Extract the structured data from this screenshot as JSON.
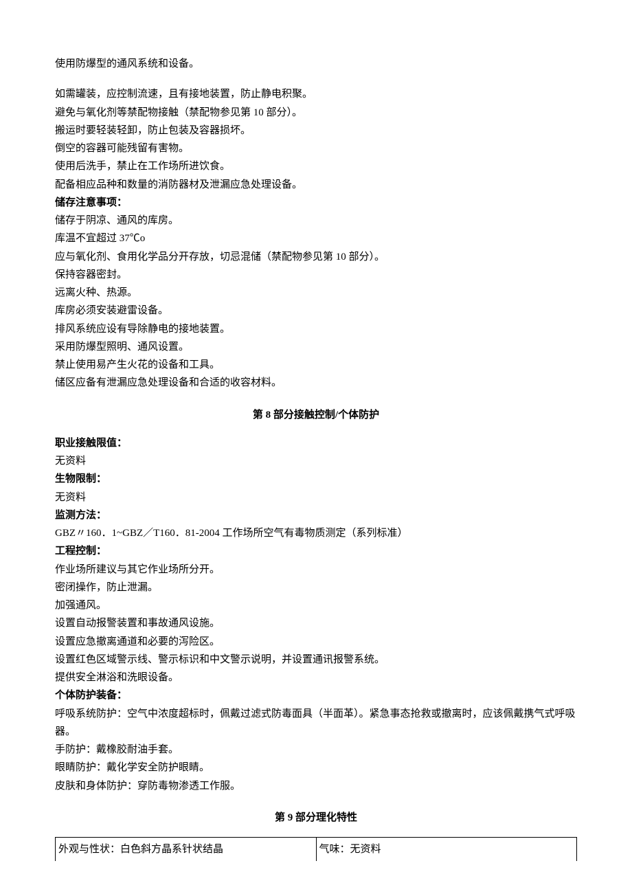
{
  "handling": {
    "lines": [
      "使用防爆型的通风系统和设备。",
      "",
      "如需罐装，应控制流速，且有接地装置，防止静电积聚。",
      "避免与氧化剂等禁配物接触（禁配物参见第 10 部分）。",
      "搬运时要轻装轻卸，防止包装及容器损坏。",
      "倒空的容器可能残留有害物。",
      "使用后洗手，禁止在工作场所进饮食。",
      "配备相应品种和数量的消防器材及泄漏应急处理设备。"
    ]
  },
  "storage": {
    "heading": "储存注意事项：",
    "lines": [
      "储存于阴凉、通风的库房。",
      "库温不宜超过 37℃o",
      "应与氧化剂、食用化学品分开存放，切忌混储（禁配物参见第 10 部分）。",
      "保持容器密封。",
      "远离火种、热源。",
      "库房必须安装避雷设备。",
      "排风系统应设有导除静电的接地装置。",
      "采用防爆型照明、通风设置。",
      "禁止使用易产生火花的设备和工具。",
      "储区应备有泄漏应急处理设备和合适的收容材料。"
    ]
  },
  "section8": {
    "title": "第 8 部分接触控制/个体防护",
    "occ_limit_label": "职业接触限值：",
    "occ_limit_value": "无资料",
    "bio_limit_label": "生物限制：",
    "bio_limit_value": "无资料",
    "monitor_label": "监测方法：",
    "monitor_value": "GBZ〃160．1~GBZ／T160．81-2004 工作场所空气有毒物质测定（系列标准）",
    "eng_label": "工程控制：",
    "eng_lines": [
      "作业场所建议与其它作业场所分开。",
      "密闭操作，防止泄漏。",
      "加强通风。",
      "设置自动报警装置和事故通风设施。",
      "设置应急撤离通道和必要的泻险区。",
      "设置红色区域警示线、警示标识和中文警示说明，并设置通讯报警系统。",
      "提供安全淋浴和洗眼设备。"
    ],
    "ppe_label": "个体防护装备：",
    "ppe_lines": [
      "呼吸系统防护：空气中浓度超标时，佩戴过滤式防毒面具（半面革）。紧急事态抢救或撤离时，应该佩戴携气式呼吸器。",
      "手防护：戴橡胶耐油手套。",
      "眼睛防护：戴化学安全防护眼睛。",
      "皮肤和身体防护：穿防毒物渗透工作服。"
    ]
  },
  "section9": {
    "title": "第 9 部分理化特性",
    "row1_left": "外观与性状：白色斜方晶系针状结晶",
    "row1_right": "气味：无资料"
  }
}
